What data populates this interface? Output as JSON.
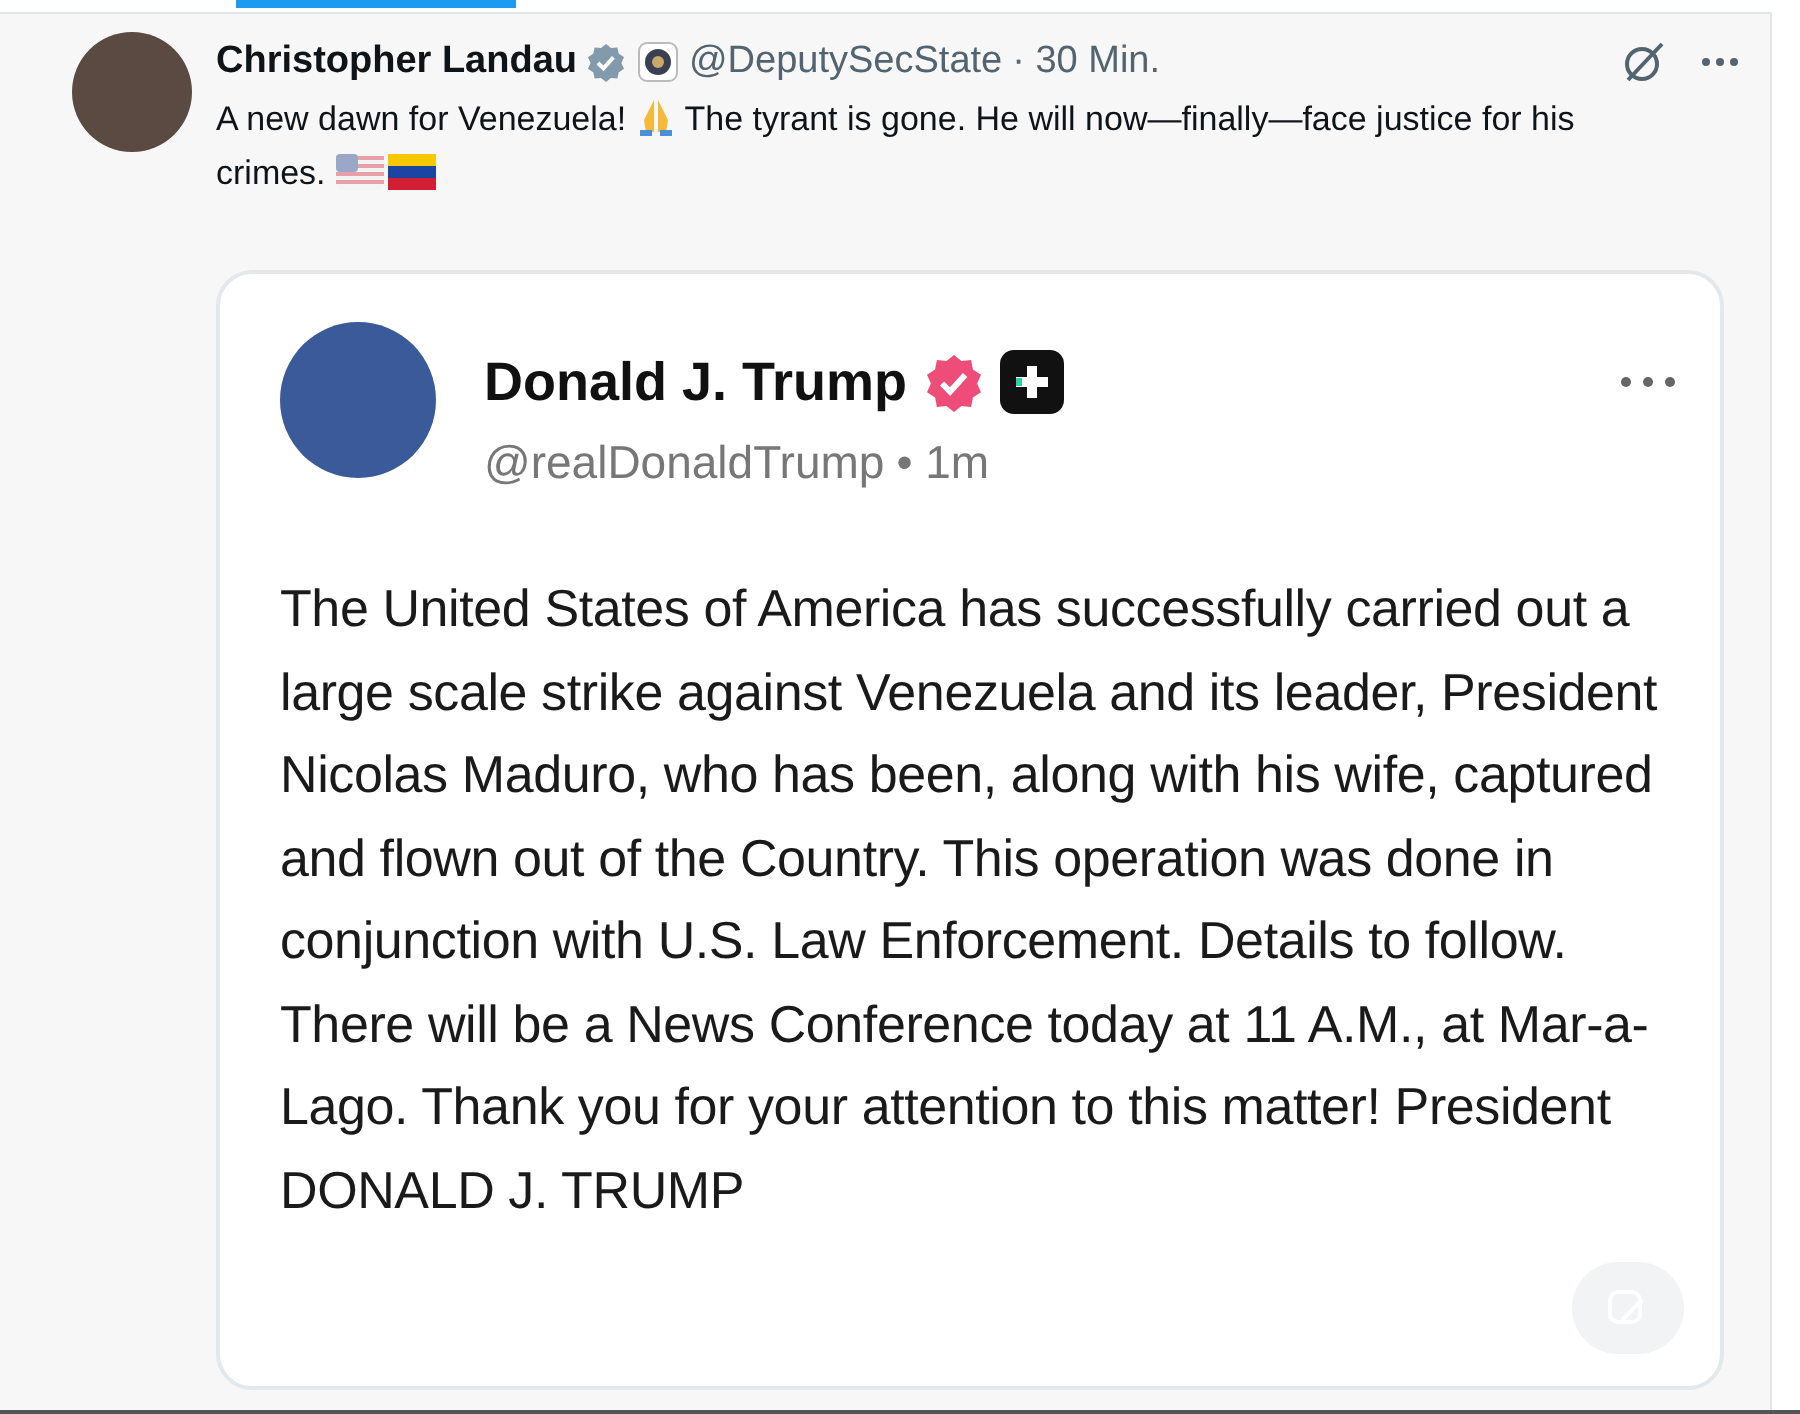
{
  "post": {
    "author": "Christopher Landau",
    "handle": "@DeputySecState",
    "time": "· 30 Min.",
    "text_1": "A new dawn for Venezuela!",
    "text_2": "The tyrant is gone. He will now—finally—face justice for his crimes."
  },
  "quoted_post": {
    "author": "Donald J. Trump",
    "handle": "@realDonaldTrump",
    "time": "• 1m",
    "text": "The United States of America has successfully carried out a large scale strike against Venezuela and its leader, President Nicolas Maduro, who has been, along with his wife, captured and flown out of the Country. This operation was done in conjunction with U.S. Law Enforcement. Details to follow. There will be a News Conference today at 11 A.M., at Mar-a-Lago. Thank you for your attention to this matter! President DONALD J. TRUMP"
  }
}
